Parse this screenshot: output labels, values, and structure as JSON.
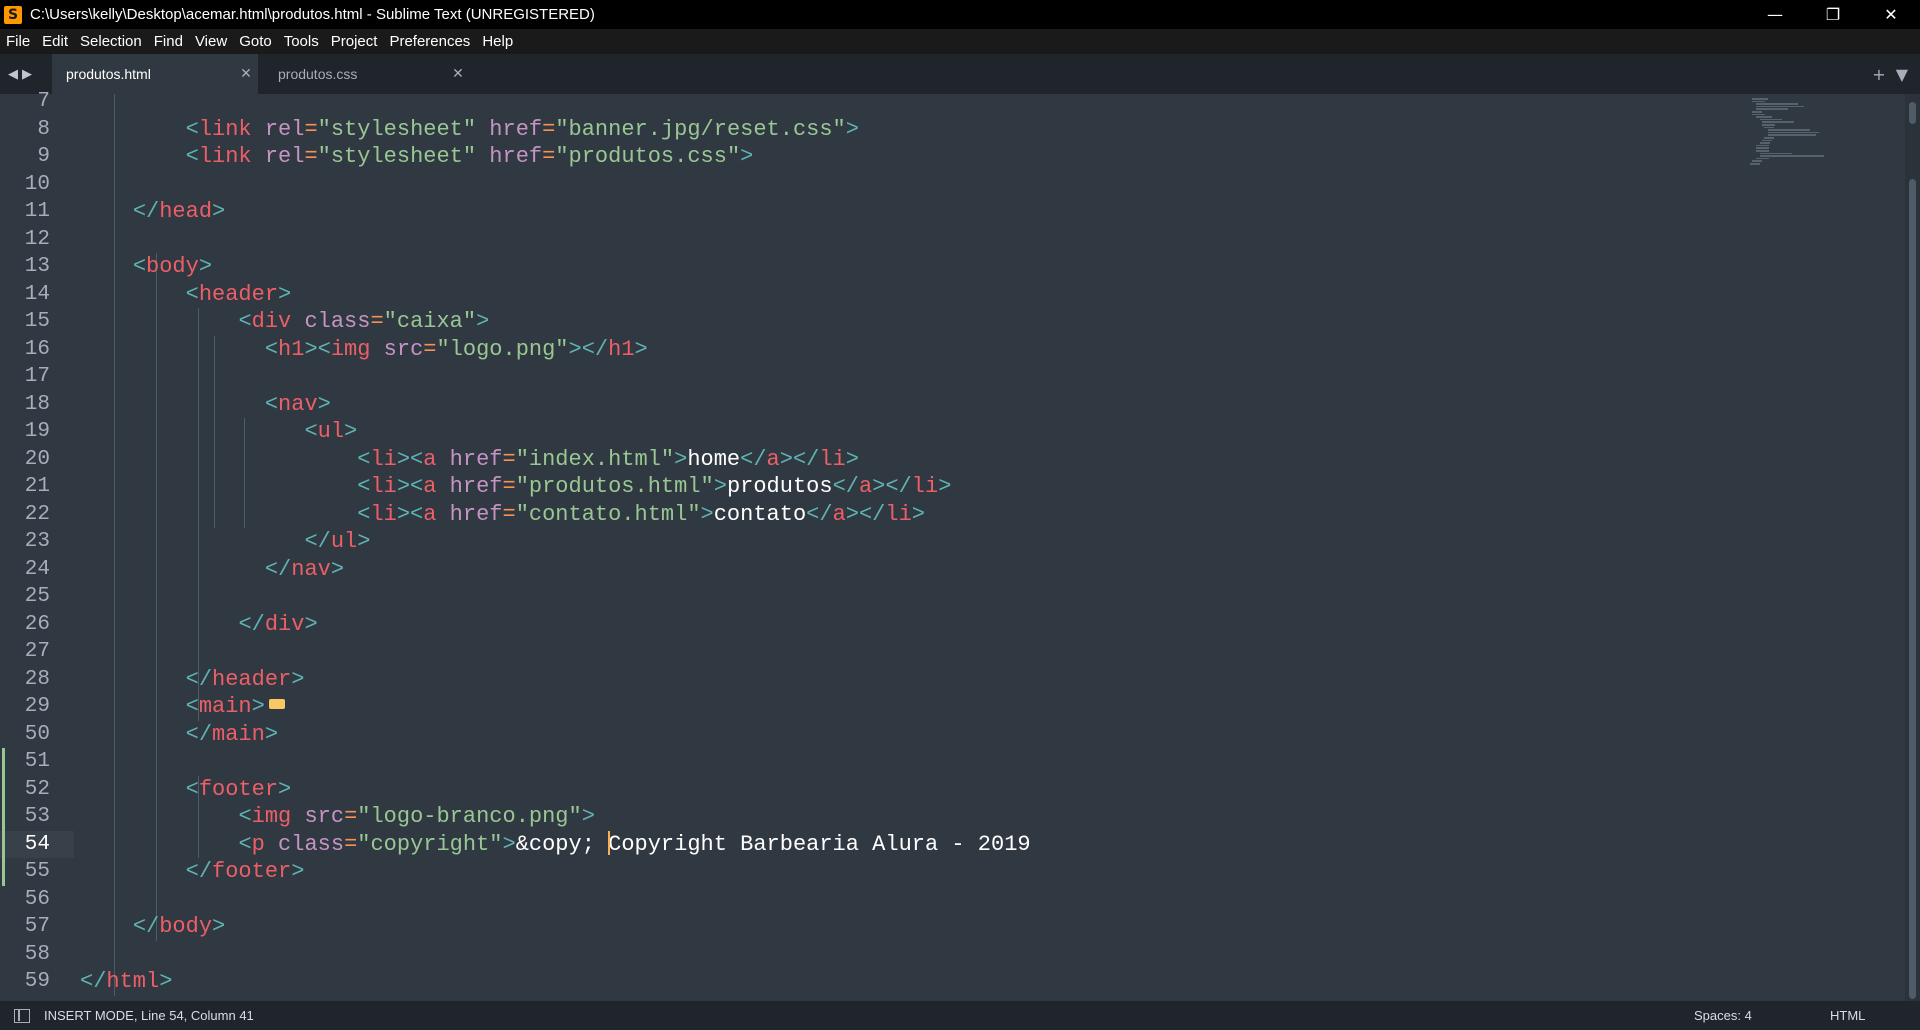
{
  "window": {
    "title": "C:\\Users\\kelly\\Desktop\\acemar.html\\produtos.html - Sublime Text (UNREGISTERED)",
    "app_icon": "S",
    "controls": {
      "minimize": "—",
      "maximize": "❐",
      "close": "✕"
    }
  },
  "menu": {
    "items": [
      "File",
      "Edit",
      "Selection",
      "Find",
      "View",
      "Goto",
      "Tools",
      "Project",
      "Preferences",
      "Help"
    ]
  },
  "tabs": {
    "nav_prev": "◀",
    "nav_next": "▶",
    "items": [
      {
        "label": "produtos.html",
        "close": "✕",
        "active": true
      },
      {
        "label": "produtos.css",
        "close": "✕",
        "active": false
      }
    ],
    "new_tab": "+",
    "tab_menu": "▼"
  },
  "editor": {
    "line_numbers": [
      "7",
      "8",
      "9",
      "10",
      "11",
      "12",
      "13",
      "14",
      "15",
      "16",
      "17",
      "18",
      "19",
      "20",
      "21",
      "22",
      "23",
      "24",
      "25",
      "26",
      "27",
      "28",
      "29",
      "50",
      "51",
      "52",
      "53",
      "54",
      "55",
      "56",
      "57",
      "58",
      "59"
    ],
    "current_line": "54",
    "code": {
      "l8": {
        "indent": "        ",
        "open": "<",
        "tag": "link",
        "a1": "rel",
        "v1": "\"stylesheet\"",
        "a2": "href",
        "v2": "\"banner.jpg/reset.css\"",
        "close": ">"
      },
      "l9": {
        "indent": "        ",
        "open": "<",
        "tag": "link",
        "a1": "rel",
        "v1": "\"stylesheet\"",
        "a2": "href",
        "v2": "\"produtos.css\"",
        "close": ">"
      },
      "l11": {
        "indent": "    ",
        "open": "</",
        "tag": "head",
        "close": ">"
      },
      "l13": {
        "indent": "    ",
        "open": "<",
        "tag": "body",
        "close": ">"
      },
      "l14": {
        "indent": "        ",
        "open": "<",
        "tag": "header",
        "close": ">"
      },
      "l15": {
        "indent": "            ",
        "open": "<",
        "tag": "div",
        "a1": "class",
        "v1": "\"caixa\"",
        "close": ">"
      },
      "l16": {
        "indent": "              ",
        "o1": "<",
        "t1": "h1",
        "c1": "><",
        "t2": "img",
        "a1": "src",
        "v1": "\"logo.png\"",
        "c2": "></",
        "t3": "h1",
        "close": ">"
      },
      "l18": {
        "indent": "              ",
        "open": "<",
        "tag": "nav",
        "close": ">"
      },
      "l19": {
        "indent": "                 ",
        "open": "<",
        "tag": "ul",
        "close": ">"
      },
      "l20": {
        "indent": "                     ",
        "o1": "<",
        "t1": "li",
        "c1": "><",
        "t2": "a",
        "a1": "href",
        "v1": "\"index.html\"",
        "c2": ">",
        "text": "home",
        "c3": "</",
        "t3": "a",
        "c4": "></",
        "t4": "li",
        "close": ">"
      },
      "l21": {
        "indent": "                     ",
        "o1": "<",
        "t1": "li",
        "c1": "><",
        "t2": "a",
        "a1": "href",
        "v1": "\"produtos.html\"",
        "c2": ">",
        "text": "produtos",
        "c3": "</",
        "t3": "a",
        "c4": "></",
        "t4": "li",
        "close": ">"
      },
      "l22": {
        "indent": "                     ",
        "o1": "<",
        "t1": "li",
        "c1": "><",
        "t2": "a",
        "a1": "href",
        "v1": "\"contato.html\"",
        "c2": ">",
        "text": "contato",
        "c3": "</",
        "t3": "a",
        "c4": "></",
        "t4": "li",
        "close": ">"
      },
      "l23": {
        "indent": "                 ",
        "open": "</",
        "tag": "ul",
        "close": ">"
      },
      "l24": {
        "indent": "              ",
        "open": "</",
        "tag": "nav",
        "close": ">"
      },
      "l26": {
        "indent": "            ",
        "open": "</",
        "tag": "div",
        "close": ">"
      },
      "l28": {
        "indent": "        ",
        "open": "</",
        "tag": "header",
        "close": ">"
      },
      "l29": {
        "indent": "        ",
        "open": "<",
        "tag": "main",
        "close": ">"
      },
      "l50": {
        "indent": "        ",
        "open": "</",
        "tag": "main",
        "close": ">"
      },
      "l52": {
        "indent": "        ",
        "open": "<",
        "tag": "footer",
        "close": ">"
      },
      "l53": {
        "indent": "            ",
        "open": "<",
        "tag": "img",
        "a1": "src",
        "v1": "\"logo-branco.png\"",
        "close": ">"
      },
      "l54": {
        "indent": "            ",
        "open": "<",
        "tag": "p",
        "a1": "class",
        "v1": "\"copyright\"",
        "close": ">",
        "entity": "&copy;",
        "text": " Copyright Barbearia Alura - 2019"
      },
      "l55": {
        "indent": "        ",
        "open": "</",
        "tag": "footer",
        "close": ">"
      },
      "l57": {
        "indent": "    ",
        "open": "</",
        "tag": "body",
        "close": ">"
      },
      "l59": {
        "indent": "",
        "open": "</",
        "tag": "html",
        "close": ">"
      }
    },
    "modified_lines": [
      "51",
      "52",
      "53",
      "54",
      "55"
    ]
  },
  "status": {
    "mode": "INSERT MODE, Line 54, Column 41",
    "spaces": "Spaces: 4",
    "syntax": "HTML"
  },
  "colors": {
    "background": "#303841",
    "tag": "#ec5f67",
    "attribute": "#c594c5",
    "string": "#99c794",
    "punctuation": "#5fb3b3",
    "caret": "#f9ae58"
  }
}
